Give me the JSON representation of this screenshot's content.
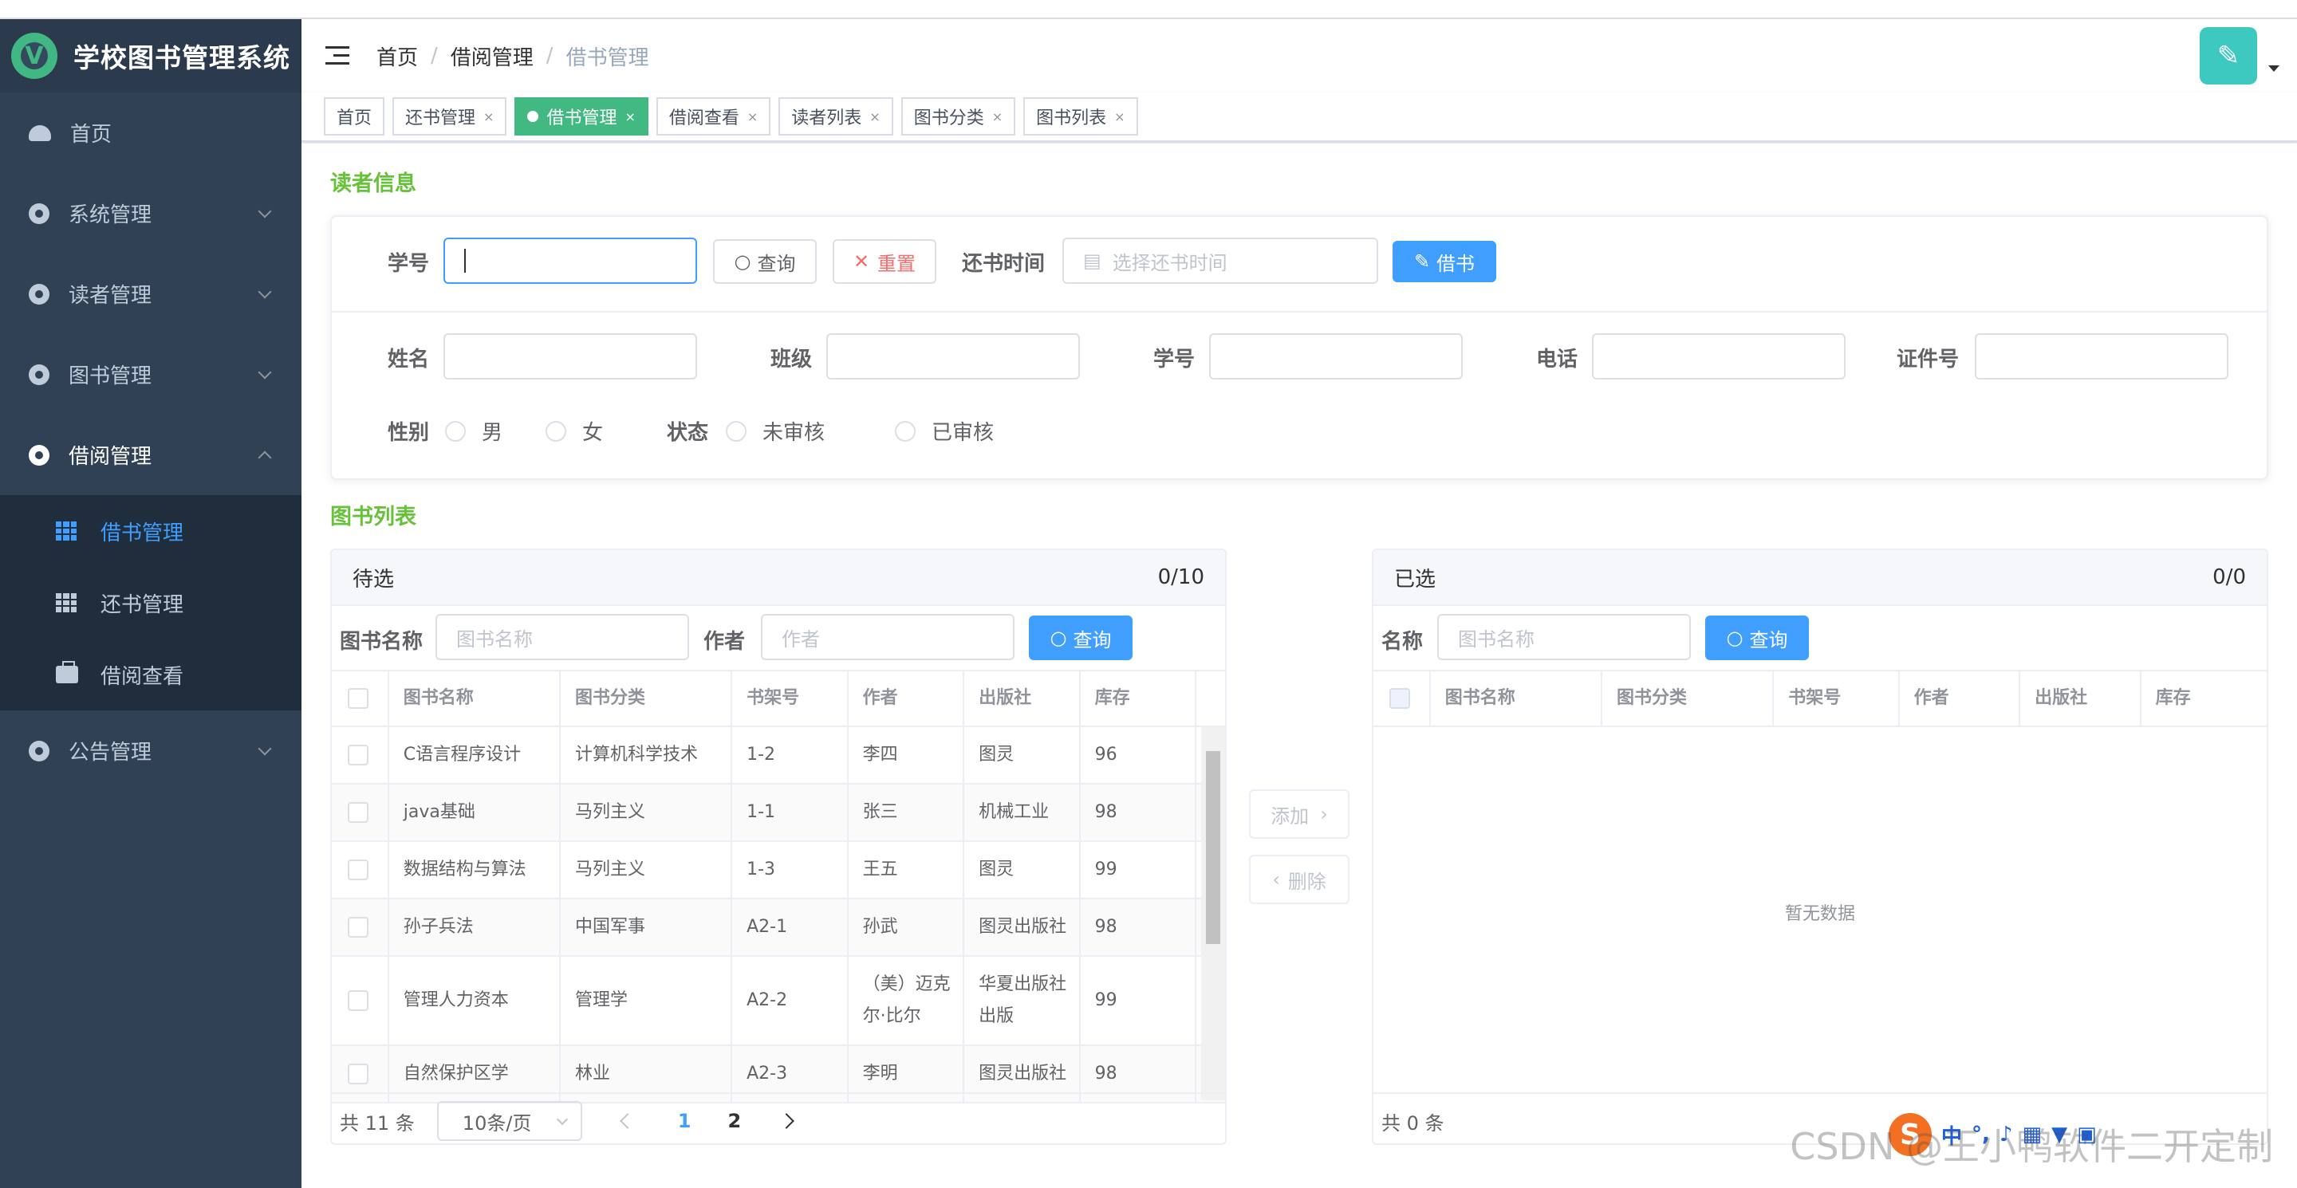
{
  "app": {
    "title": "学校图书管理系统",
    "logo_letter": "V"
  },
  "sidebar": {
    "items": [
      {
        "label": "首页"
      },
      {
        "label": "系统管理"
      },
      {
        "label": "读者管理"
      },
      {
        "label": "图书管理"
      },
      {
        "label": "借阅管理"
      },
      {
        "label": "公告管理"
      }
    ],
    "submenu": [
      {
        "label": "借书管理"
      },
      {
        "label": "还书管理"
      },
      {
        "label": "借阅查看"
      }
    ]
  },
  "breadcrumb": [
    "首页",
    "借阅管理",
    "借书管理"
  ],
  "breadcrumb_sep": "/",
  "tags": [
    {
      "label": "首页",
      "close": ""
    },
    {
      "label": "还书管理",
      "close": "×"
    },
    {
      "label": "借书管理",
      "close": "×"
    },
    {
      "label": "借阅查看",
      "close": "×"
    },
    {
      "label": "读者列表",
      "close": "×"
    },
    {
      "label": "图书分类",
      "close": "×"
    },
    {
      "label": "图书列表",
      "close": "×"
    }
  ],
  "reader": {
    "section_title": "读者信息",
    "student_id_label": "学号",
    "query_button": "查询",
    "reset_button": "重置",
    "return_time_label": "还书时间",
    "return_time_placeholder": "选择还书时间",
    "borrow_button": "借书",
    "fields": [
      {
        "label": "姓名"
      },
      {
        "label": "班级"
      },
      {
        "label": "学号"
      },
      {
        "label": "电话"
      },
      {
        "label": "证件号"
      }
    ],
    "gender_label": "性别",
    "gender_options": [
      "男",
      "女"
    ],
    "status_label": "状态",
    "status_options": [
      "未审核",
      "已审核"
    ]
  },
  "books": {
    "section_title": "图书列表",
    "left": {
      "title": "待选",
      "count": "0/10",
      "name_label": "图书名称",
      "name_placeholder": "图书名称",
      "author_label": "作者",
      "author_placeholder": "作者",
      "query_button": "查询",
      "columns": [
        "图书名称",
        "图书分类",
        "书架号",
        "作者",
        "出版社",
        "库存"
      ],
      "rows": [
        [
          "C语言程序设计",
          "计算机科学技术",
          "1-2",
          "李四",
          "图灵",
          "96"
        ],
        [
          "java基础",
          "马列主义",
          "1-1",
          "张三",
          "机械工业",
          "98"
        ],
        [
          "数据结构与算法",
          "马列主义",
          "1-3",
          "王五",
          "图灵",
          "99"
        ],
        [
          "孙子兵法",
          "中国军事",
          "A2-1",
          "孙武",
          "图灵出版社",
          "98"
        ],
        [
          "管理人力资本",
          "管理学",
          "A2-2",
          "（美）迈克尔·比尔",
          "华夏出版社出版",
          "99"
        ],
        [
          "自然保护区学",
          "林业",
          "A2-3",
          "李明",
          "图灵出版社",
          "98"
        ]
      ],
      "total": "共 11 条",
      "page_size": "10条/页",
      "pages": [
        "1",
        "2"
      ]
    },
    "transfer": {
      "add": "添加",
      "remove": "删除"
    },
    "right": {
      "title": "已选",
      "count": "0/0",
      "name_label": "名称",
      "name_placeholder": "图书名称",
      "query_button": "查询",
      "columns": [
        "图书名称",
        "图书分类",
        "书架号",
        "作者",
        "出版社",
        "库存"
      ],
      "empty_text": "暂无数据",
      "total": "共 0 条"
    }
  },
  "watermark": "CSDN @王小鸭软件二开定制",
  "ime": {
    "logo": "S",
    "lang": "中"
  },
  "colors": {
    "sidebar_bg": "#304156",
    "active_tag": "#42b983",
    "primary": "#409eff",
    "section_title": "#67c23a"
  }
}
